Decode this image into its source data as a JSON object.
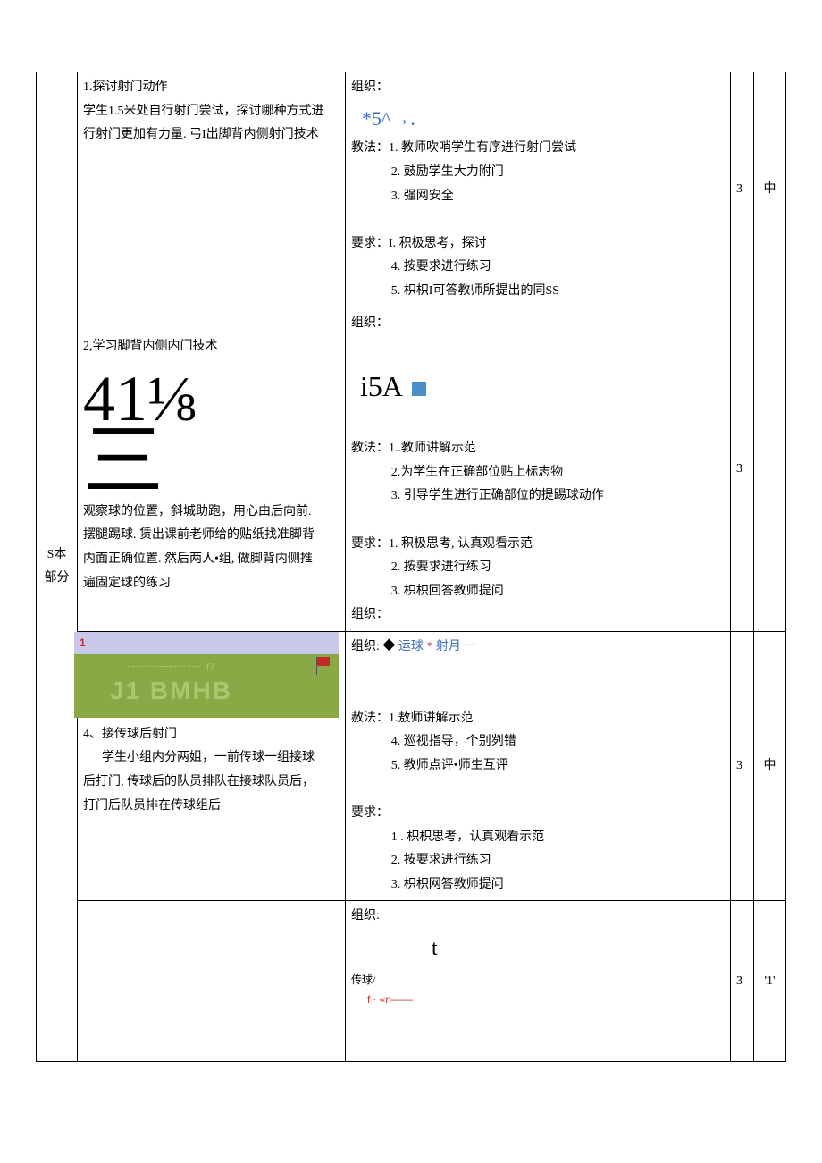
{
  "label": "S本部分",
  "left": {
    "s1_title": "1.探讨射门动作",
    "s1_body1": "学生1.5米处自行射门尝试，探讨哪种方式进",
    "s1_body2": "行射门更加有力量. 弓I出脚背内侧射门技术",
    "s2_title": "2,学习脚背内侧内门技术",
    "s2_num": "41⅛",
    "s2_bars": "三",
    "s2_p1": "观察球的位置，斜城助跑，用心由后向前.",
    "s2_p2": "摆腿踢球. 赁出课前老师给的贴纸找准脚背",
    "s2_p3": "内面正确位置. 然后两人•组, 做脚背内侧推",
    "s2_p4": "遍固定球的练习",
    "s3_band_num1": "1",
    "s3_band_dashlbl": "f7",
    "s3_band_big": "J1  BMHB",
    "s4_title": "4、接传球后射门",
    "s4_p1": "学生小组内分两姐，一前传球一组接球",
    "s4_p2": "后打门, 传球后的队员排队在接球队员后，",
    "s4_p3": "打门后队员排在传球组后"
  },
  "right": {
    "r1_zz": "组织：",
    "r1_star": "*5^→.",
    "r1_jf": "教法：1. 教师吹哨学生有序进行射门尝试",
    "r1_jf2": "2. 鼓励学生大力附门",
    "r1_jf3": "3. 强网安全",
    "r1_yq": "要求：I. 积极思考，探讨",
    "r1_yq2": "4. 按要求进行练习",
    "r1_yq3": "5. 枳枳I可答教师所提出的同SS",
    "r2_zz": "组织：",
    "r2_i5a": "i5A",
    "r2_jf": "教法：1..教师讲解示范",
    "r2_jf2": "2.为学生在正确部位贴上标志物",
    "r2_jf3": "3. 引导学生进行正确部位的提踢球动作",
    "r2_yq": "要求：1. 积极思考, 认真观看示范",
    "r2_yq2": "2. 按要求进行练习",
    "r2_yq3": "3. 枳枳回答教师提问",
    "r3_zz0": "组织：",
    "r3_zz": "组织:  ",
    "r3_zz_diamond": "◆",
    "r3_zz_lbl1": "运球",
    "r3_zz_star": "*",
    "r3_zz_lbl2": "射月",
    "r3_zz_dash": "一",
    "r3_jf": "赦法：1.敖师讲解示范",
    "r3_jf2": "4. 巡视指导，个别刿错",
    "r3_jf3": "5. 教师点评•师生互评",
    "r3_yq": "要求：",
    "r3_yq1": "1 . 枳枳思考，认真观看示范",
    "r3_yq2": "2. 按要求进行练习",
    "r3_yq3": "3. 枳枳网答教师提问",
    "r4_zz": "组织:",
    "r4_t": "t",
    "r4_cq": "传球/",
    "r4_fn": "f~ «n——"
  },
  "nums": {
    "n1": "3",
    "n2": "3",
    "n3": "3",
    "n4": "3"
  },
  "mid": {
    "m1": "中",
    "m3": "中",
    "m4": "'1'"
  }
}
